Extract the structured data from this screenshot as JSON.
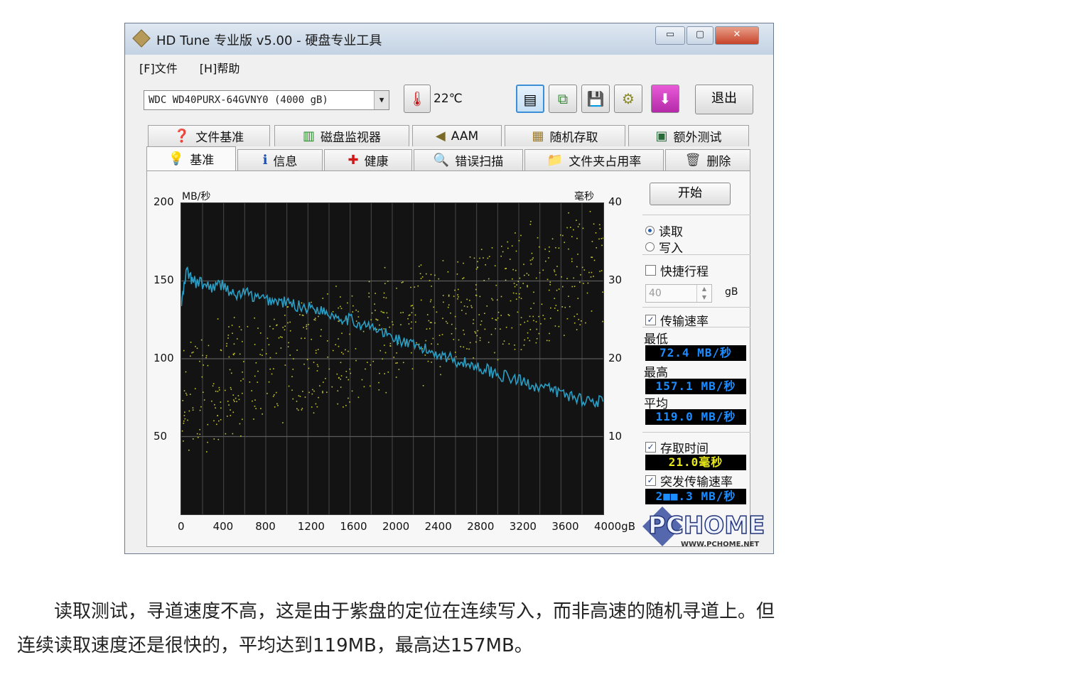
{
  "window": {
    "title": "HD Tune 专业版 v5.00 - 硬盘专业工具",
    "minimize": "▭",
    "maximize": "▢",
    "close": "✕"
  },
  "menu": [
    "[F]文件",
    "[H]帮助"
  ],
  "toolbar": {
    "drive": "WDC    WD40PURX-64GVNY0 (4000 gB)",
    "temperature": "22℃",
    "exit": "退出",
    "icons": [
      "thermometer-icon",
      "benchmark-icon",
      "copy-icon",
      "save-icon",
      "options-icon",
      "download-icon"
    ]
  },
  "tabs_top": [
    {
      "label": "文件基准",
      "icon": "file-benchmark-icon",
      "glyph": "❓"
    },
    {
      "label": "磁盘监视器",
      "icon": "disk-monitor-icon",
      "glyph": "▥"
    },
    {
      "label": "AAM",
      "icon": "speaker-icon",
      "glyph": "◀"
    },
    {
      "label": "随机存取",
      "icon": "random-access-icon",
      "glyph": "▦"
    },
    {
      "label": "额外测试",
      "icon": "extra-tests-icon",
      "glyph": "▣"
    }
  ],
  "tabs_bottom": [
    {
      "label": "基准",
      "icon": "lightbulb-icon",
      "glyph": "💡"
    },
    {
      "label": "信息",
      "icon": "info-icon",
      "glyph": "ℹ"
    },
    {
      "label": "健康",
      "icon": "health-cross-icon",
      "glyph": "✚"
    },
    {
      "label": "错误扫描",
      "icon": "magnifier-icon",
      "glyph": "🔍"
    },
    {
      "label": "文件夹占用率",
      "icon": "folder-icon",
      "glyph": "📁"
    },
    {
      "label": "删除",
      "icon": "trash-icon",
      "glyph": "🗑"
    }
  ],
  "side": {
    "start": "开始",
    "read": "读取",
    "write": "写入",
    "short_stroke": "快捷行程",
    "short_stroke_value": "40",
    "short_stroke_unit": "gB",
    "transfer_rate": "传输速率",
    "min_label": "最低",
    "min_value": "72.4 MB/秒",
    "max_label": "最高",
    "max_value": "157.1 MB/秒",
    "avg_label": "平均",
    "avg_value": "119.0 MB/秒",
    "access_time": "存取时间",
    "access_value": "21.0毫秒",
    "burst_rate": "突发传输速率",
    "burst_value": "2■■.3 MB/秒"
  },
  "logo": {
    "text": "PCHOME",
    "url": "WWW.PCHOME.NET"
  },
  "chart_data": {
    "type": "line",
    "left_unit": "MB/秒",
    "right_unit": "毫秒",
    "ylim": [
      0,
      200
    ],
    "y2lim": [
      0,
      40
    ],
    "xlim": [
      0,
      4000
    ],
    "y_ticks": [
      "200",
      "150",
      "100",
      "50"
    ],
    "y2_ticks": [
      "40",
      "30",
      "20",
      "10"
    ],
    "x_ticks": [
      "0",
      "400",
      "800",
      "1200",
      "1600",
      "2000",
      "2400",
      "2800",
      "3200",
      "3600",
      "4000gB"
    ],
    "grid": true,
    "series": [
      {
        "kind": "transfer_rate",
        "color": "#2a9ec4",
        "x": [
          0,
          50,
          100,
          200,
          300,
          400,
          500,
          600,
          700,
          800,
          900,
          1000,
          1100,
          1200,
          1300,
          1400,
          1500,
          1600,
          1700,
          1800,
          1900,
          2000,
          2100,
          2200,
          2300,
          2400,
          2500,
          2600,
          2700,
          2800,
          2900,
          3000,
          3100,
          3200,
          3300,
          3400,
          3500,
          3600,
          3700,
          3800,
          3900,
          4000
        ],
        "values": [
          135,
          157,
          150,
          148,
          146,
          148,
          140,
          143,
          139,
          138,
          137,
          136,
          134,
          133,
          132,
          129,
          127,
          125,
          122,
          120,
          117,
          114,
          111,
          108,
          106,
          104,
          102,
          99,
          97,
          95,
          93,
          90,
          88,
          86,
          84,
          82,
          80,
          78,
          76,
          74,
          73,
          72.4
        ]
      },
      {
        "kind": "access_time",
        "color": "#c7c832",
        "x_range": [
          0,
          4000
        ],
        "y2_range": [
          8,
          38
        ],
        "description_points": 700
      }
    ]
  },
  "caption": [
    "　　读取测试，寻道速度不高，这是由于紫盘的定位在连续写入，而非高速的随机寻道上。但",
    "连续读取速度还是很快的，平均达到119MB，最高达157MB。"
  ]
}
